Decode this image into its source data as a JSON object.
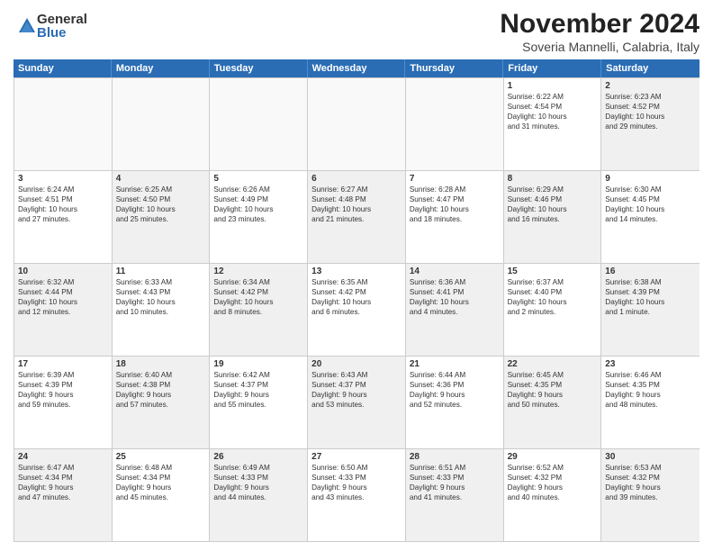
{
  "logo": {
    "general": "General",
    "blue": "Blue"
  },
  "title": "November 2024",
  "location": "Soveria Mannelli, Calabria, Italy",
  "days": [
    "Sunday",
    "Monday",
    "Tuesday",
    "Wednesday",
    "Thursday",
    "Friday",
    "Saturday"
  ],
  "weeks": [
    [
      {
        "day": "",
        "empty": true
      },
      {
        "day": "",
        "empty": true
      },
      {
        "day": "",
        "empty": true
      },
      {
        "day": "",
        "empty": true
      },
      {
        "day": "",
        "empty": true
      },
      {
        "day": "1",
        "lines": [
          "Sunrise: 6:22 AM",
          "Sunset: 4:54 PM",
          "Daylight: 10 hours",
          "and 31 minutes."
        ]
      },
      {
        "day": "2",
        "shaded": true,
        "lines": [
          "Sunrise: 6:23 AM",
          "Sunset: 4:52 PM",
          "Daylight: 10 hours",
          "and 29 minutes."
        ]
      }
    ],
    [
      {
        "day": "3",
        "lines": [
          "Sunrise: 6:24 AM",
          "Sunset: 4:51 PM",
          "Daylight: 10 hours",
          "and 27 minutes."
        ]
      },
      {
        "day": "4",
        "shaded": true,
        "lines": [
          "Sunrise: 6:25 AM",
          "Sunset: 4:50 PM",
          "Daylight: 10 hours",
          "and 25 minutes."
        ]
      },
      {
        "day": "5",
        "lines": [
          "Sunrise: 6:26 AM",
          "Sunset: 4:49 PM",
          "Daylight: 10 hours",
          "and 23 minutes."
        ]
      },
      {
        "day": "6",
        "shaded": true,
        "lines": [
          "Sunrise: 6:27 AM",
          "Sunset: 4:48 PM",
          "Daylight: 10 hours",
          "and 21 minutes."
        ]
      },
      {
        "day": "7",
        "lines": [
          "Sunrise: 6:28 AM",
          "Sunset: 4:47 PM",
          "Daylight: 10 hours",
          "and 18 minutes."
        ]
      },
      {
        "day": "8",
        "shaded": true,
        "lines": [
          "Sunrise: 6:29 AM",
          "Sunset: 4:46 PM",
          "Daylight: 10 hours",
          "and 16 minutes."
        ]
      },
      {
        "day": "9",
        "lines": [
          "Sunrise: 6:30 AM",
          "Sunset: 4:45 PM",
          "Daylight: 10 hours",
          "and 14 minutes."
        ]
      }
    ],
    [
      {
        "day": "10",
        "shaded": true,
        "lines": [
          "Sunrise: 6:32 AM",
          "Sunset: 4:44 PM",
          "Daylight: 10 hours",
          "and 12 minutes."
        ]
      },
      {
        "day": "11",
        "lines": [
          "Sunrise: 6:33 AM",
          "Sunset: 4:43 PM",
          "Daylight: 10 hours",
          "and 10 minutes."
        ]
      },
      {
        "day": "12",
        "shaded": true,
        "lines": [
          "Sunrise: 6:34 AM",
          "Sunset: 4:42 PM",
          "Daylight: 10 hours",
          "and 8 minutes."
        ]
      },
      {
        "day": "13",
        "lines": [
          "Sunrise: 6:35 AM",
          "Sunset: 4:42 PM",
          "Daylight: 10 hours",
          "and 6 minutes."
        ]
      },
      {
        "day": "14",
        "shaded": true,
        "lines": [
          "Sunrise: 6:36 AM",
          "Sunset: 4:41 PM",
          "Daylight: 10 hours",
          "and 4 minutes."
        ]
      },
      {
        "day": "15",
        "lines": [
          "Sunrise: 6:37 AM",
          "Sunset: 4:40 PM",
          "Daylight: 10 hours",
          "and 2 minutes."
        ]
      },
      {
        "day": "16",
        "shaded": true,
        "lines": [
          "Sunrise: 6:38 AM",
          "Sunset: 4:39 PM",
          "Daylight: 10 hours",
          "and 1 minute."
        ]
      }
    ],
    [
      {
        "day": "17",
        "lines": [
          "Sunrise: 6:39 AM",
          "Sunset: 4:39 PM",
          "Daylight: 9 hours",
          "and 59 minutes."
        ]
      },
      {
        "day": "18",
        "shaded": true,
        "lines": [
          "Sunrise: 6:40 AM",
          "Sunset: 4:38 PM",
          "Daylight: 9 hours",
          "and 57 minutes."
        ]
      },
      {
        "day": "19",
        "lines": [
          "Sunrise: 6:42 AM",
          "Sunset: 4:37 PM",
          "Daylight: 9 hours",
          "and 55 minutes."
        ]
      },
      {
        "day": "20",
        "shaded": true,
        "lines": [
          "Sunrise: 6:43 AM",
          "Sunset: 4:37 PM",
          "Daylight: 9 hours",
          "and 53 minutes."
        ]
      },
      {
        "day": "21",
        "lines": [
          "Sunrise: 6:44 AM",
          "Sunset: 4:36 PM",
          "Daylight: 9 hours",
          "and 52 minutes."
        ]
      },
      {
        "day": "22",
        "shaded": true,
        "lines": [
          "Sunrise: 6:45 AM",
          "Sunset: 4:35 PM",
          "Daylight: 9 hours",
          "and 50 minutes."
        ]
      },
      {
        "day": "23",
        "lines": [
          "Sunrise: 6:46 AM",
          "Sunset: 4:35 PM",
          "Daylight: 9 hours",
          "and 48 minutes."
        ]
      }
    ],
    [
      {
        "day": "24",
        "shaded": true,
        "lines": [
          "Sunrise: 6:47 AM",
          "Sunset: 4:34 PM",
          "Daylight: 9 hours",
          "and 47 minutes."
        ]
      },
      {
        "day": "25",
        "lines": [
          "Sunrise: 6:48 AM",
          "Sunset: 4:34 PM",
          "Daylight: 9 hours",
          "and 45 minutes."
        ]
      },
      {
        "day": "26",
        "shaded": true,
        "lines": [
          "Sunrise: 6:49 AM",
          "Sunset: 4:33 PM",
          "Daylight: 9 hours",
          "and 44 minutes."
        ]
      },
      {
        "day": "27",
        "lines": [
          "Sunrise: 6:50 AM",
          "Sunset: 4:33 PM",
          "Daylight: 9 hours",
          "and 43 minutes."
        ]
      },
      {
        "day": "28",
        "shaded": true,
        "lines": [
          "Sunrise: 6:51 AM",
          "Sunset: 4:33 PM",
          "Daylight: 9 hours",
          "and 41 minutes."
        ]
      },
      {
        "day": "29",
        "lines": [
          "Sunrise: 6:52 AM",
          "Sunset: 4:32 PM",
          "Daylight: 9 hours",
          "and 40 minutes."
        ]
      },
      {
        "day": "30",
        "shaded": true,
        "lines": [
          "Sunrise: 6:53 AM",
          "Sunset: 4:32 PM",
          "Daylight: 9 hours",
          "and 39 minutes."
        ]
      }
    ]
  ]
}
